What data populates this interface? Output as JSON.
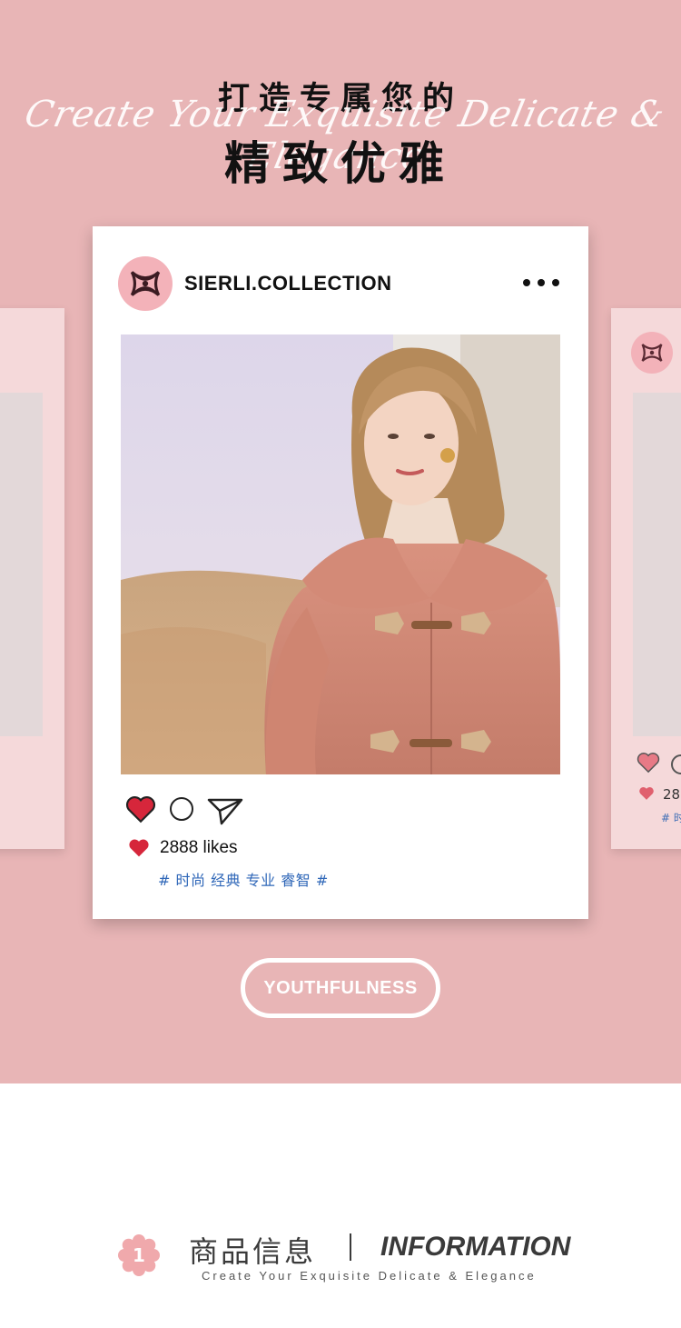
{
  "header": {
    "title_line1": "打造专属您的",
    "script_line": "Create Your Exquisite Delicate & Elegance",
    "title_line2": "精致优雅"
  },
  "card": {
    "username": "SIERLI.COLLECTION",
    "likes": "2888 likes",
    "tags": "# 时尚 经典 专业 睿智 #",
    "icons": [
      "logo-icon",
      "more-icon",
      "heart-icon",
      "comment-icon",
      "share-icon"
    ]
  },
  "side_card_right": {
    "likes": "28",
    "tag": "# 时"
  },
  "pill_label": "YOUTHFULNESS",
  "section": {
    "number": "1",
    "title_cn": "商品信息",
    "title_en": "INFORMATION",
    "subtitle": "Create Your Exquisite Delicate & Elegance"
  },
  "colors": {
    "background_pink": "#e8b5b6",
    "side_card": "#f5d9da",
    "heart_red": "#d6263b",
    "tag_blue": "#2f67b8",
    "logo_pink": "#f3b2b9"
  }
}
